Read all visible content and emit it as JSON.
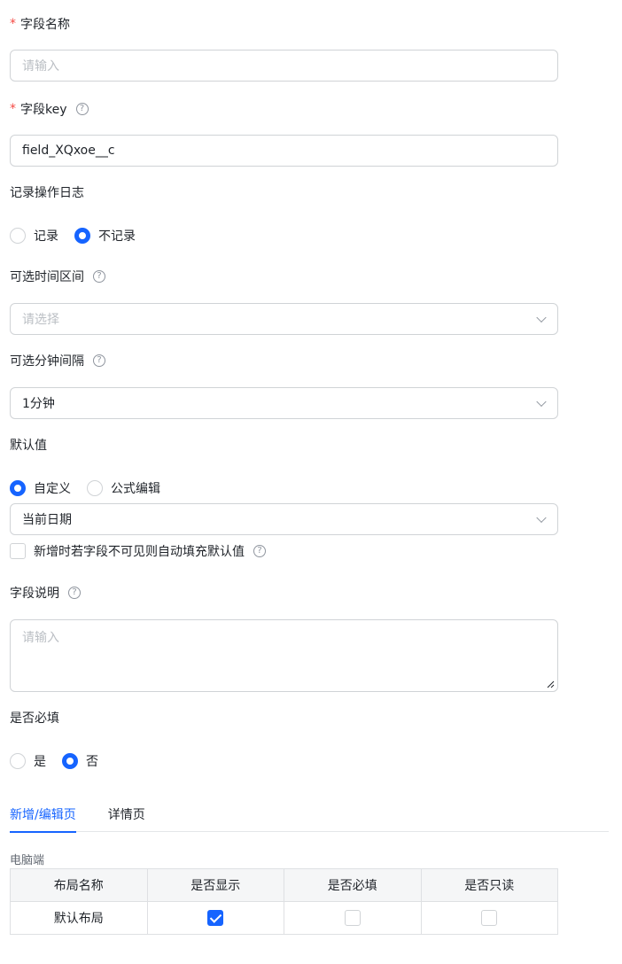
{
  "field_name": {
    "label": "字段名称",
    "required_mark": "*",
    "placeholder": "请输入"
  },
  "field_key": {
    "label": "字段key",
    "required_mark": "*",
    "value": "field_XQxoe__c"
  },
  "operation_log": {
    "label": "记录操作日志",
    "options": [
      "记录",
      "不记录"
    ],
    "selected": "不记录"
  },
  "time_range": {
    "label": "可选时间区间",
    "placeholder": "请选择"
  },
  "minute_interval": {
    "label": "可选分钟间隔",
    "value": "1分钟"
  },
  "default_value": {
    "label": "默认值",
    "options": [
      "自定义",
      "公式编辑"
    ],
    "selected": "自定义",
    "select_value": "当前日期",
    "autofill_label": "新增时若字段不可见则自动填充默认值",
    "autofill_checked": false
  },
  "field_desc": {
    "label": "字段说明",
    "placeholder": "请输入"
  },
  "required": {
    "label": "是否必填",
    "options": [
      "是",
      "否"
    ],
    "selected": "否"
  },
  "tabs": [
    {
      "label": "新增/编辑页",
      "active": true
    },
    {
      "label": "详情页",
      "active": false
    }
  ],
  "layout_section": {
    "title": "电脑端",
    "headers": [
      "布局名称",
      "是否显示",
      "是否必填",
      "是否只读"
    ],
    "rows": [
      {
        "name": "默认布局",
        "show": true,
        "required": false,
        "readonly": false
      }
    ]
  },
  "colors": {
    "accent": "#1664ff",
    "required": "#f54a45",
    "border": "#d0d3d6",
    "placeholder": "#bbbfc4"
  },
  "icons": {
    "help": "question-circle-icon",
    "dropdown": "chevron-down-icon",
    "check": "check-icon"
  }
}
